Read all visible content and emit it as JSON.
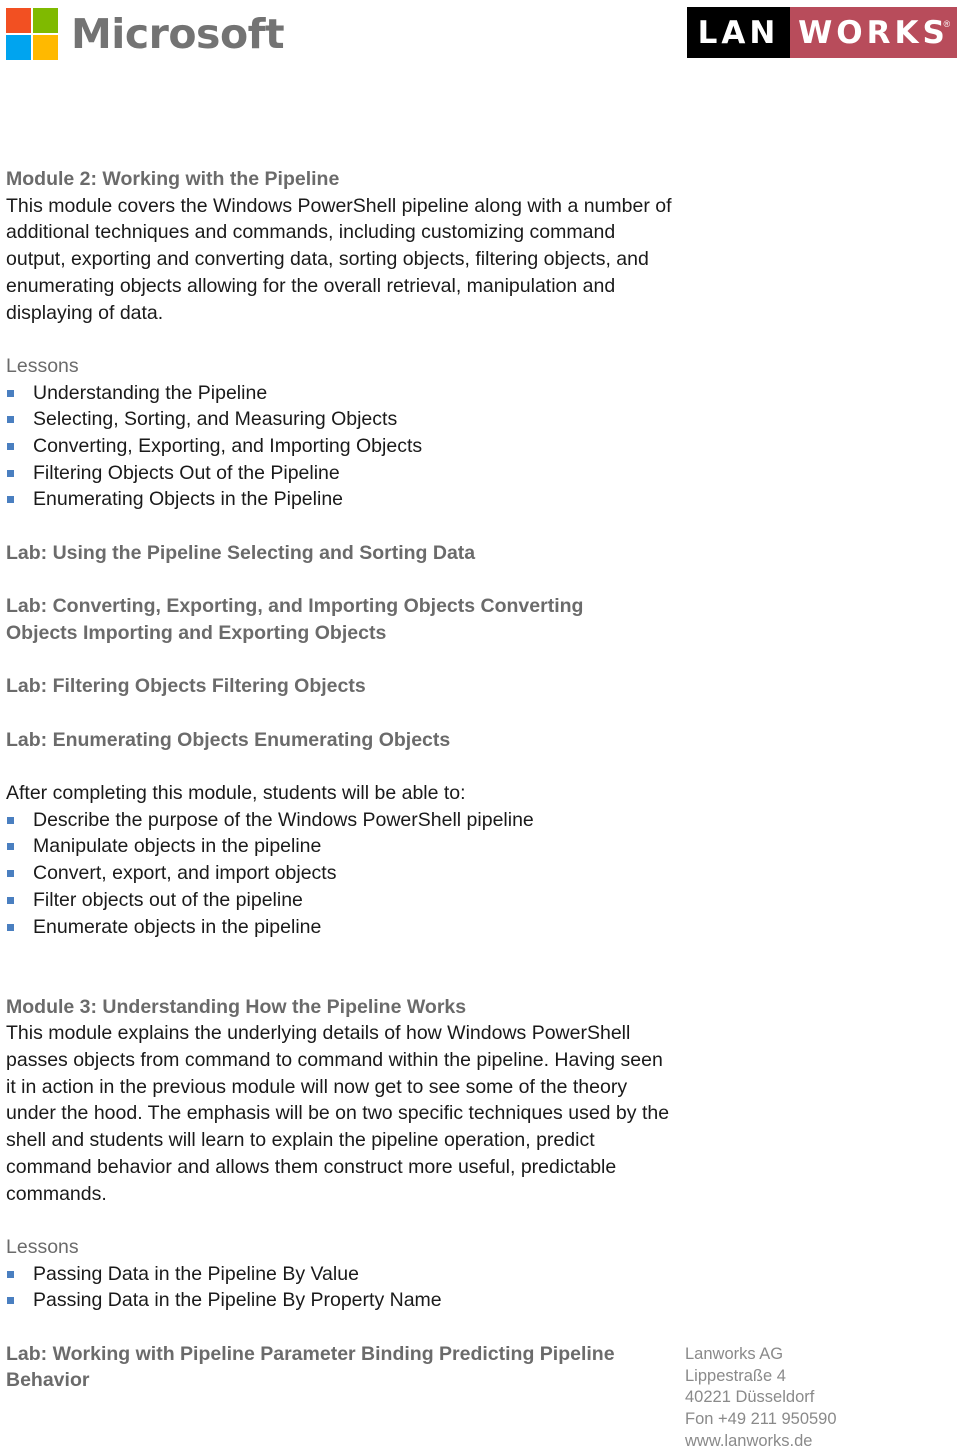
{
  "header": {
    "microsoft_logo_text": "Microsoft",
    "microsoft_logo_colors": [
      "#f25022",
      "#7fba00",
      "#00a4ef",
      "#ffb900"
    ],
    "lanworks_logo": {
      "left": "LAN",
      "right": "WORKS",
      "registered": "®",
      "accent_color": "#b84c5b"
    }
  },
  "module2": {
    "title": "Module 2: Working with the Pipeline",
    "description": "This module covers the Windows PowerShell pipeline along with a number of additional techniques and commands, including customizing command output, exporting and converting data, sorting objects, filtering objects, and enumerating objects allowing for the overall retrieval, manipulation and displaying of data.",
    "lessons_label": "Lessons",
    "lessons": [
      "Understanding the Pipeline",
      "Selecting, Sorting, and Measuring Objects",
      "Converting, Exporting, and Importing Objects",
      "Filtering Objects Out of the Pipeline",
      "Enumerating Objects in the Pipeline"
    ],
    "labs": [
      "Lab: Using the Pipeline Selecting and Sorting Data",
      "Lab: Converting, Exporting, and Importing Objects Converting Objects Importing and Exporting Objects",
      "Lab: Filtering Objects Filtering Objects",
      "Lab: Enumerating Objects Enumerating Objects"
    ],
    "outcomes_intro": "After completing this module, students will be able to:",
    "outcomes": [
      "Describe the purpose of the Windows PowerShell pipeline",
      "Manipulate objects in the pipeline",
      "Convert, export, and import objects",
      "Filter objects out of the pipeline",
      "Enumerate objects in the pipeline"
    ]
  },
  "module3": {
    "title": "Module 3: Understanding How the Pipeline Works",
    "description": "This module explains the underlying details of how Windows PowerShell passes objects from command to command within the pipeline. Having seen it in action in the previous module will now get to see some of the theory under the hood. The emphasis will be on two specific techniques used by the shell and students will learn to explain the pipeline operation, predict command behavior and allows them construct more useful, predictable commands.",
    "lessons_label": "Lessons",
    "lessons": [
      "Passing Data in the Pipeline By Value",
      "Passing Data in the Pipeline By Property Name"
    ],
    "labs": [
      "Lab: Working with Pipeline Parameter Binding Predicting Pipeline Behavior"
    ]
  },
  "footer": {
    "company": "Lanworks AG",
    "street": "Lippestraße 4",
    "city": "40221 Düsseldorf",
    "phone": "Fon +49 211 950590",
    "website": "www.lanworks.de"
  }
}
